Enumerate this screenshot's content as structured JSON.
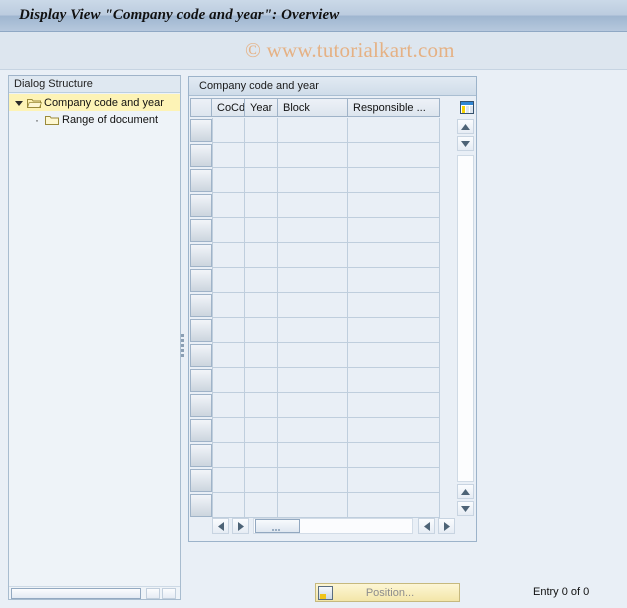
{
  "window": {
    "title": "Display View \"Company code and year\": Overview",
    "watermark": "© www.tutorialkart.com"
  },
  "tree": {
    "header": "Dialog Structure",
    "nodes": [
      {
        "label": "Company code and year",
        "icon": "open-folder-icon",
        "expanded": true,
        "selected": true,
        "level": 1
      },
      {
        "label": "Range of document",
        "icon": "closed-folder-icon",
        "expanded": false,
        "selected": false,
        "level": 2
      }
    ]
  },
  "table": {
    "title": "Company code and year",
    "columns": [
      {
        "key": "cocd",
        "label": "CoCd"
      },
      {
        "key": "year",
        "label": "Year"
      },
      {
        "key": "block",
        "label": "Block"
      },
      {
        "key": "responsible",
        "label": "Responsible ..."
      }
    ],
    "rows": [],
    "row_placeholder_count": 16,
    "config_icon": "table-settings-icon"
  },
  "scroll": {
    "up_arrow": "▲",
    "down_arrow": "▼",
    "left_arrow": "◀",
    "right_arrow": "▶"
  },
  "footer": {
    "position_button": "Position...",
    "position_icon": "position-icon",
    "entry_status": "Entry 0 of 0"
  },
  "colors": {
    "title_bar": "#b6c8dd",
    "watermark": "#e5b184",
    "selection": "#fdf3b6",
    "panel_bg": "#e9eff6",
    "button_yellow": "#f3e6a8"
  }
}
